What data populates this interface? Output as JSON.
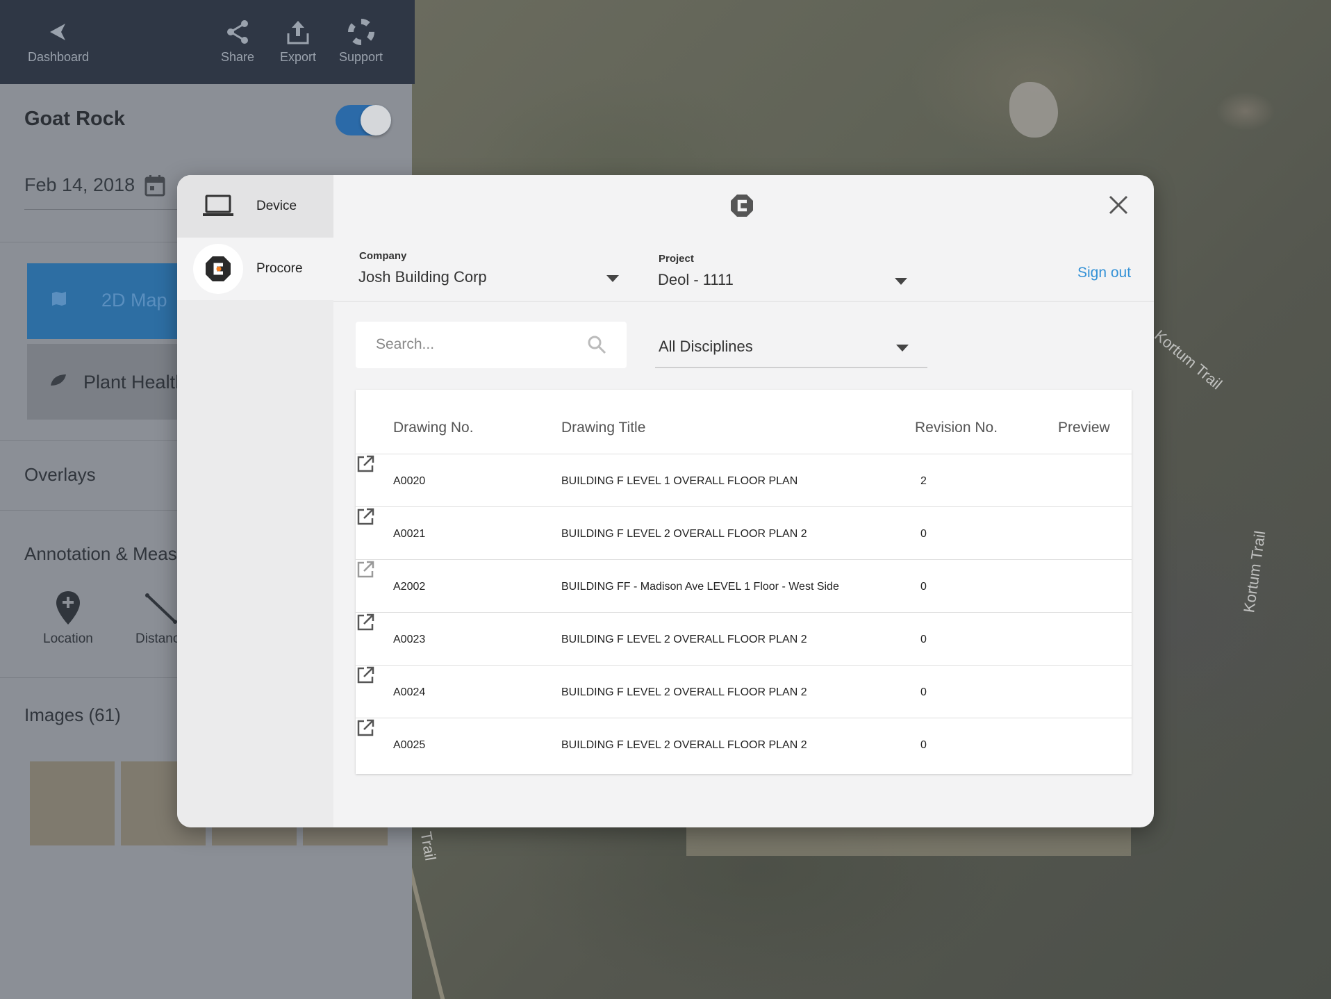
{
  "topbar": {
    "dashboard_label": "Dashboard",
    "share_label": "Share",
    "export_label": "Export",
    "support_label": "Support"
  },
  "panel": {
    "title": "Goat Rock",
    "date": "Feb 14, 2018",
    "modes": [
      {
        "label": "2D Map",
        "icon": "map-icon"
      },
      {
        "label": "Plant Health",
        "icon": "leaf-icon"
      }
    ],
    "overlays_heading": "Overlays",
    "annotation_heading": "Annotation & Measurement",
    "tools": [
      {
        "label": "Location",
        "icon": "location-pin-icon"
      },
      {
        "label": "Distance",
        "icon": "ruler-icon"
      }
    ],
    "images_heading": "Images (61)"
  },
  "map": {
    "labels": [
      "Kortum Trail",
      "Kortum Trail",
      "Trail"
    ]
  },
  "modal": {
    "sources": [
      {
        "label": "Device",
        "icon": "laptop-icon"
      },
      {
        "label": "Procore",
        "icon": "procore-logo-icon"
      }
    ],
    "company_label": "Company",
    "company_value": "Josh Building Corp",
    "project_label": "Project",
    "project_value": "Deol - 1111",
    "sign_out_label": "Sign out",
    "search_placeholder": "Search...",
    "discipline_value": "All Disciplines",
    "table": {
      "headers": [
        "Drawing No.",
        "Drawing Title",
        "Revision No.",
        "Preview"
      ],
      "rows": [
        {
          "no": "A0020",
          "title": "BUILDING F LEVEL 1 OVERALL FLOOR PLAN",
          "rev": "2"
        },
        {
          "no": "A0021",
          "title": "BUILDING F LEVEL 2 OVERALL FLOOR PLAN 2",
          "rev": "0"
        },
        {
          "no": "A2002",
          "title": "BUILDING FF - Madison Ave LEVEL 1 Floor - West Side",
          "rev": "0"
        },
        {
          "no": "A0023",
          "title": "BUILDING F LEVEL 2 OVERALL FLOOR PLAN 2",
          "rev": "0"
        },
        {
          "no": "A0024",
          "title": "BUILDING F LEVEL 2 OVERALL FLOOR PLAN 2",
          "rev": "0"
        },
        {
          "no": "A0025",
          "title": "BUILDING F LEVEL 2 OVERALL FLOOR PLAN 2",
          "rev": "0"
        }
      ]
    }
  },
  "colors": {
    "accent": "#3391d6",
    "procore_orange": "#f47e20",
    "topbar": "#2f3745"
  }
}
